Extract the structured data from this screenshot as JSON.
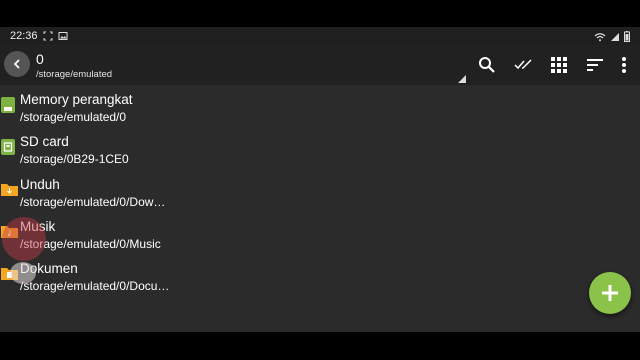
{
  "status_bar": {
    "time": "22:36",
    "icons": [
      "screenshot-icon",
      "gallery-icon",
      "wifi-icon",
      "signal-icon",
      "battery-icon"
    ]
  },
  "toolbar": {
    "title": "0",
    "subtitle": "/storage/emulated",
    "actions": [
      "search-icon",
      "select-all-icon",
      "grid-view-icon",
      "sort-icon",
      "more-vert-icon"
    ]
  },
  "items": [
    {
      "name": "Memory perangkat",
      "path": "/storage/emulated/0",
      "icon": "phone-storage-icon",
      "color": "#7cb342"
    },
    {
      "name": "SD card",
      "path": "/storage/0B29-1CE0",
      "icon": "sd-card-icon",
      "color": "#7cb342"
    },
    {
      "name": "Unduh",
      "path": "/storage/emulated/0/Dow…",
      "icon": "download-folder-icon",
      "color": "#f5a623"
    },
    {
      "name": "Musik",
      "path": "/storage/emulated/0/Music",
      "icon": "music-folder-icon",
      "color": "#f5a623"
    },
    {
      "name": "Dokumen",
      "path": "/storage/emulated/0/Docu…",
      "icon": "documents-folder-icon",
      "color": "#f5a623"
    }
  ],
  "fab": {
    "icon": "add-icon",
    "color": "#8bc34a"
  }
}
